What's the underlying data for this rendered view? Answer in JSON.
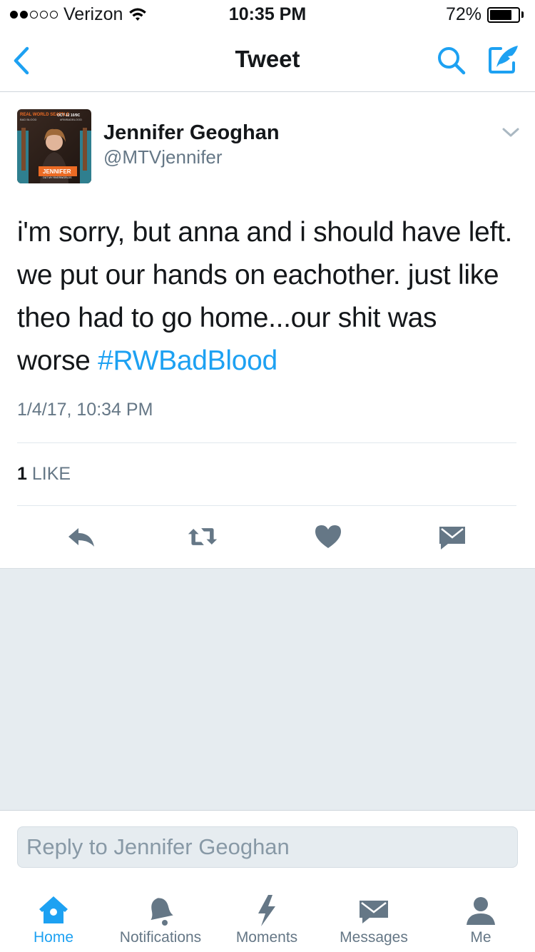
{
  "status_bar": {
    "carrier": "Verizon",
    "time": "10:35 PM",
    "battery": "72%"
  },
  "nav": {
    "title": "Tweet"
  },
  "tweet": {
    "author_name": "Jennifer Geoghan",
    "author_handle": "@MTVjennifer",
    "text_before": "i'm sorry, but anna and i should have left. we put our hands on eachother. just like theo had to go home...our shit was worse",
    "hashtag": "#RWBadBlood",
    "timestamp": "1/4/17, 10:34 PM",
    "like_count": "1",
    "like_label": "LIKE",
    "avatar_text": {
      "top_left": "REAL WORLD SEATTLE",
      "sub_left": "BAD BLOOD",
      "top_right": "OCT 12 10/9C",
      "sub_right": "#RWBADBLOOD",
      "name_banner": "JENNIFER",
      "sub_banner": "OUT MY RIVERWORLDS"
    }
  },
  "reply": {
    "placeholder": "Reply to Jennifer Geoghan"
  },
  "tabs": [
    {
      "label": "Home",
      "icon": "home-icon",
      "active": true
    },
    {
      "label": "Notifications",
      "icon": "bell-icon",
      "active": false
    },
    {
      "label": "Moments",
      "icon": "lightning-icon",
      "active": false
    },
    {
      "label": "Messages",
      "icon": "envelope-icon",
      "active": false
    },
    {
      "label": "Me",
      "icon": "person-icon",
      "active": false
    }
  ],
  "colors": {
    "accent": "#1da1f2",
    "secondary_text": "#657786",
    "icon_gray": "#657786",
    "background_gray": "#e6ecf0"
  }
}
